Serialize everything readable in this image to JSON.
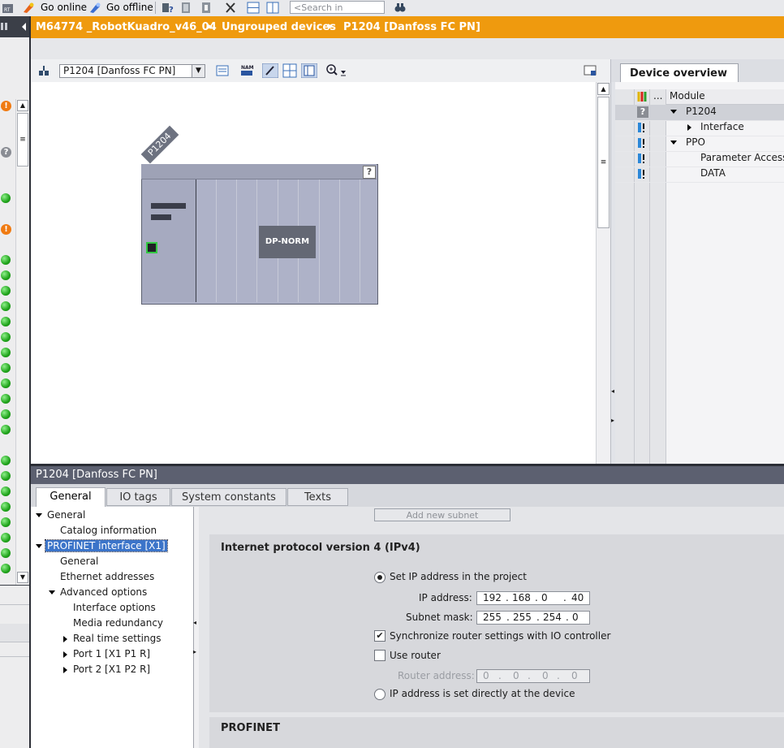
{
  "toolbar": {
    "go_online": "Go online",
    "go_offline": "Go offline",
    "search_placeholder": "<Search in project>"
  },
  "breadcrumb": [
    "M64774 _RobotKuadro_v46_04",
    "Ungrouped devices",
    "P1204 [Danfoss FC PN]"
  ],
  "device_view": {
    "selected_device": "P1204 [Danfoss FC PN]",
    "device_label": "P1204",
    "module_label": "DP-NORM"
  },
  "overview": {
    "tab": "Device overview",
    "col_dots": "...",
    "col_module": "Module",
    "rows": [
      "P1204",
      "Interface",
      "PPO",
      "Parameter Access I",
      "DATA"
    ]
  },
  "props": {
    "title": "P1204 [Danfoss FC PN]",
    "tabs": [
      "General",
      "IO tags",
      "System constants",
      "Texts"
    ],
    "nav": [
      "General",
      "Catalog information",
      "PROFINET interface [X1]",
      "General",
      "Ethernet addresses",
      "Advanced options",
      "Interface options",
      "Media redundancy",
      "Real time settings",
      "Port 1 [X1 P1 R]",
      "Port 2 [X1 P2 R]"
    ],
    "add_subnet": "Add new subnet",
    "ipv4_title": "Internet protocol version 4 (IPv4)",
    "set_ip_label": "Set IP address in the project",
    "ip_label": "IP address:",
    "ip": [
      "192",
      "168",
      "0",
      "40"
    ],
    "mask_label": "Subnet mask:",
    "mask": [
      "255",
      "255",
      "254",
      "0"
    ],
    "sync_label": "Synchronize router settings with IO controller",
    "use_router_label": "Use router",
    "router_label": "Router address:",
    "router": [
      "0",
      "0",
      "0",
      "0"
    ],
    "direct_label": "IP address is set directly at the device",
    "profinet_title": "PROFINET"
  },
  "colors": {
    "accent": "#ef9a0e",
    "status_ok": "#1fa31a",
    "status_warn": "#f07b12"
  }
}
